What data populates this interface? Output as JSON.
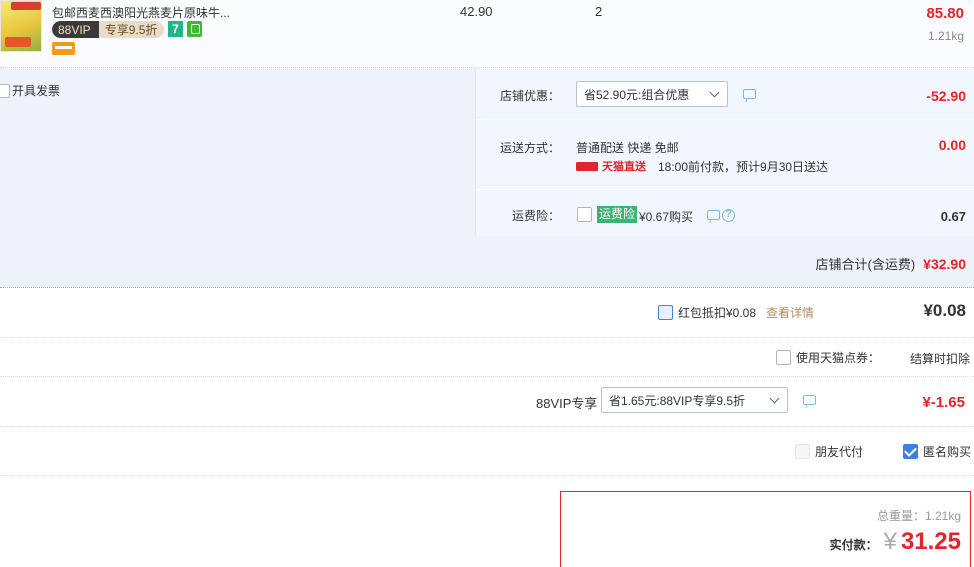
{
  "product": {
    "title": "包邮西麦西澳阳光燕麦片原味牛...",
    "vip_label": "88VIP",
    "vip_discount": "专享9.5折",
    "badge_7": "7",
    "unit_price": "42.90",
    "quantity": "2",
    "subtotal": "85.80",
    "weight": "1.21kg"
  },
  "invoice": {
    "label": "开具发票"
  },
  "shop_options": {
    "discount": {
      "label": "店铺优惠：",
      "selected": "省52.90元:组合优惠",
      "amount": "-52.90"
    },
    "shipping": {
      "label": "运送方式：",
      "method": "普通配送 快递 免邮",
      "tmall_direct": "天猫直送",
      "eta": "18:00前付款，预计9月30日送达",
      "amount": "0.00"
    },
    "insurance": {
      "label": "运费险：",
      "tag": "运费险",
      "price": "¥0.67购买",
      "amount": "0.67"
    }
  },
  "shop_total": {
    "label": "店铺合计(含运费)",
    "value": "¥32.90"
  },
  "red_packet": {
    "label": "红包抵扣¥0.08",
    "link": "查看详情",
    "amount": "¥0.08"
  },
  "tmall_points": {
    "label": "使用天猫点券：",
    "note": "结算时扣除"
  },
  "vip_exclusive": {
    "label": "88VIP专享",
    "selected": "省1.65元:88VIP专享9.5折",
    "amount": "¥-1.65"
  },
  "purchase_options": {
    "friend_pay": "朋友代付",
    "anonymous": "匿名购买"
  },
  "payment": {
    "total_weight": "总重量：1.21kg",
    "label": "实付款：",
    "currency": "¥",
    "amount": "31.25"
  }
}
